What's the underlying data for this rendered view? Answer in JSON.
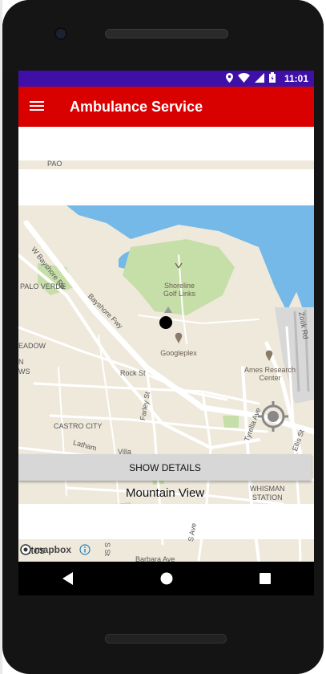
{
  "status_bar": {
    "time": "11:01",
    "icons": [
      "location-icon",
      "wifi-icon",
      "signal-icon",
      "battery-icon"
    ]
  },
  "app_bar": {
    "title": "Ambulance Service",
    "menu_icon": "menu-icon"
  },
  "map": {
    "labels": {
      "w_bayshore_rd": "W Bayshore Rd",
      "bayshore_fwy": "Bayshore Fwy",
      "palo_verde": "PALO VERDE",
      "meadow": "EADOW",
      "n_truncated": "N",
      "ws": "WS",
      "castro_city": "CASTRO CITY",
      "rock_st": "Rock St",
      "farley_st": "Farley St",
      "latham": "Latham",
      "villa": "Villa",
      "tyrella_ave": "Tyrella Ave",
      "ellis_st": "Ellis St",
      "zook_rd": "Zook Rd",
      "whisman_station": "WHISMAN\nSTATION",
      "mountain_view": "Mountain View",
      "shoreline_golf": "Shoreline\nGolf Links",
      "googleplex": "Googleplex",
      "ames_research": "Ames Research\nCenter",
      "pao": "PAO",
      "barbara_ave": "Barbara Ave",
      "s_st": "S St",
      "s_ave": "S Ave"
    },
    "attribution": "mapbox",
    "partial_text": "Altos"
  },
  "actions": {
    "show_details": "SHOW DETAILS"
  },
  "colors": {
    "status_bar": "#3f10a8",
    "app_bar": "#d90000",
    "water": "#74b9e8",
    "park": "#c6dfa8",
    "land": "#efe9dc",
    "road": "#ffffff"
  }
}
